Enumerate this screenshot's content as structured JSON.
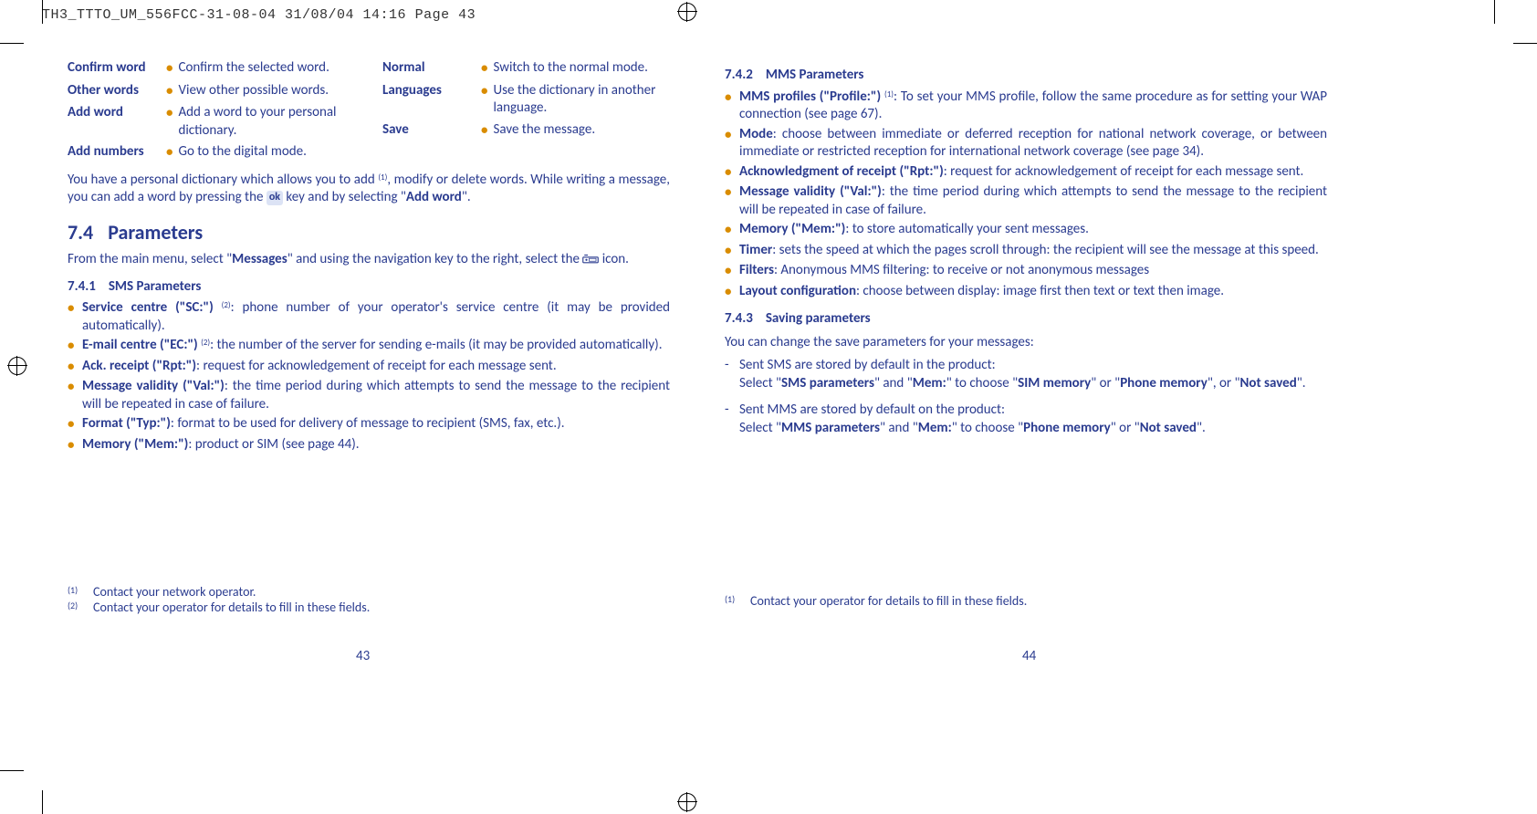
{
  "header": "TH3_TTTO_UM_556FCC-31-08-04  31/08/04  14:16  Page 43",
  "left": {
    "terms_col1": [
      {
        "label": "Confirm word",
        "desc": "Confirm the selected word."
      },
      {
        "label": "Other words",
        "desc": "View other possible words."
      },
      {
        "label": "Add word",
        "desc": "Add a word to your personal dictionary."
      },
      {
        "label": "Add numbers",
        "desc": "Go to the digital mode."
      }
    ],
    "terms_col2": [
      {
        "label": "Normal",
        "desc": "Switch to the normal mode."
      },
      {
        "label": "Languages",
        "desc": "Use the dictionary in another language."
      },
      {
        "label": "Save",
        "desc": "Save the message."
      }
    ],
    "dict_para_a": "You have a personal dictionary which allows you to add ",
    "dict_para_b": ", modify or delete words. While writing a message, you can add a word by pressing the ",
    "dict_para_c": " key and by selecting \"",
    "dict_para_d": "\".",
    "ok": "ok",
    "add_word_bold": "Add word",
    "sup1": "(1)",
    "section_num": "7.4",
    "section_title": "Parameters",
    "params_intro_a": "From the main menu, select \"",
    "params_intro_b": "\" and using the navigation key to the right, select the ",
    "params_intro_c": " icon.",
    "messages_bold": "Messages",
    "sub1_num": "7.4.1",
    "sub1_title": "SMS Parameters",
    "sms_items": [
      {
        "bold": "Service centre (\"SC:\") ",
        "sup": "(2)",
        "rest": ": phone number of your operator's service centre (it may be provided automatically)."
      },
      {
        "bold": "E-mail centre (\"EC:\") ",
        "sup": "(2)",
        "rest": ": the number of the server for sending e-mails (it may be provided automatically)."
      },
      {
        "bold": "Ack. receipt (\"Rpt:\")",
        "sup": "",
        "rest": ": request for acknowledgement of receipt for each message sent."
      },
      {
        "bold": "Message validity (\"Val:\")",
        "sup": "",
        "rest": ": the time period during which attempts to send the message to the recipient will be repeated in case of failure."
      },
      {
        "bold": "Format (\"Typ:\")",
        "sup": "",
        "rest": ": format to be used for delivery of message to recipient (SMS, fax, etc.)."
      },
      {
        "bold": "Memory (\"Mem:\")",
        "sup": "",
        "rest": ": product or SIM (see page 44)."
      }
    ],
    "footnotes": [
      {
        "mark": "(1)",
        "text": "Contact your network operator."
      },
      {
        "mark": "(2)",
        "text": "Contact your operator for details to fill in these fields."
      }
    ],
    "pagenum": "43"
  },
  "right": {
    "sub2_num": "7.4.2",
    "sub2_title": "MMS Parameters",
    "mms_items": [
      {
        "bold": "MMS profiles (\"Profile:\") ",
        "sup": "(1)",
        "rest": ": To set your MMS profile, follow the same procedure as for setting your WAP connection (see page 67)."
      },
      {
        "bold": "Mode",
        "sup": "",
        "rest": ": choose between immediate or deferred reception for national network coverage, or between immediate or restricted reception for international network coverage (see page 34)."
      },
      {
        "bold": "Acknowledgment of receipt (\"Rpt:\")",
        "sup": "",
        "rest": ": request for acknowledgement of receipt for each message sent."
      },
      {
        "bold": "Message validity (\"Val:\")",
        "sup": "",
        "rest": ": the time period during which attempts to send the message to the recipient will be repeated in case of failure."
      },
      {
        "bold": "Memory (\"Mem:\")",
        "sup": "",
        "rest": ": to store automatically your sent messages."
      },
      {
        "bold": "Timer",
        "sup": "",
        "rest": ": sets the speed at which the pages scroll through: the recipient will see the message at this speed."
      },
      {
        "bold": "Filters",
        "sup": "",
        "rest": ": Anonymous MMS filtering: to receive or not anonymous messages"
      },
      {
        "bold": "Layout configuration",
        "sup": "",
        "rest": ": choose between display: image first then text or text then image."
      }
    ],
    "sub3_num": "7.4.3",
    "sub3_title": "Saving parameters",
    "saving_intro": "You can change the save parameters for your messages:",
    "dash_items": [
      {
        "line1": "Sent SMS are stored by default in the product:",
        "line2_pre": "Select \"",
        "b1": "SMS parameters",
        "mid1": "\" and \"",
        "b2": "Mem:",
        "mid2": "\" to choose \"",
        "b3": "SIM memory",
        "mid3": "\" or \"",
        "b4": "Phone memory",
        "mid4": "\", or \"",
        "b5": "Not saved",
        "end": "\"."
      },
      {
        "line1": "Sent MMS are stored by default on the product:",
        "line2_pre": "Select \"",
        "b1": "MMS parameters",
        "mid1": "\" and \"",
        "b2": "Mem:",
        "mid2": "\" to choose \"",
        "b3": "Phone memory",
        "mid3": "\" or \"",
        "b4": "Not saved",
        "mid4": "",
        "b5": "",
        "end": "\"."
      }
    ],
    "footnotes": [
      {
        "mark": "(1)",
        "text": "Contact your operator for details to fill in these fields."
      }
    ],
    "pagenum": "44"
  }
}
